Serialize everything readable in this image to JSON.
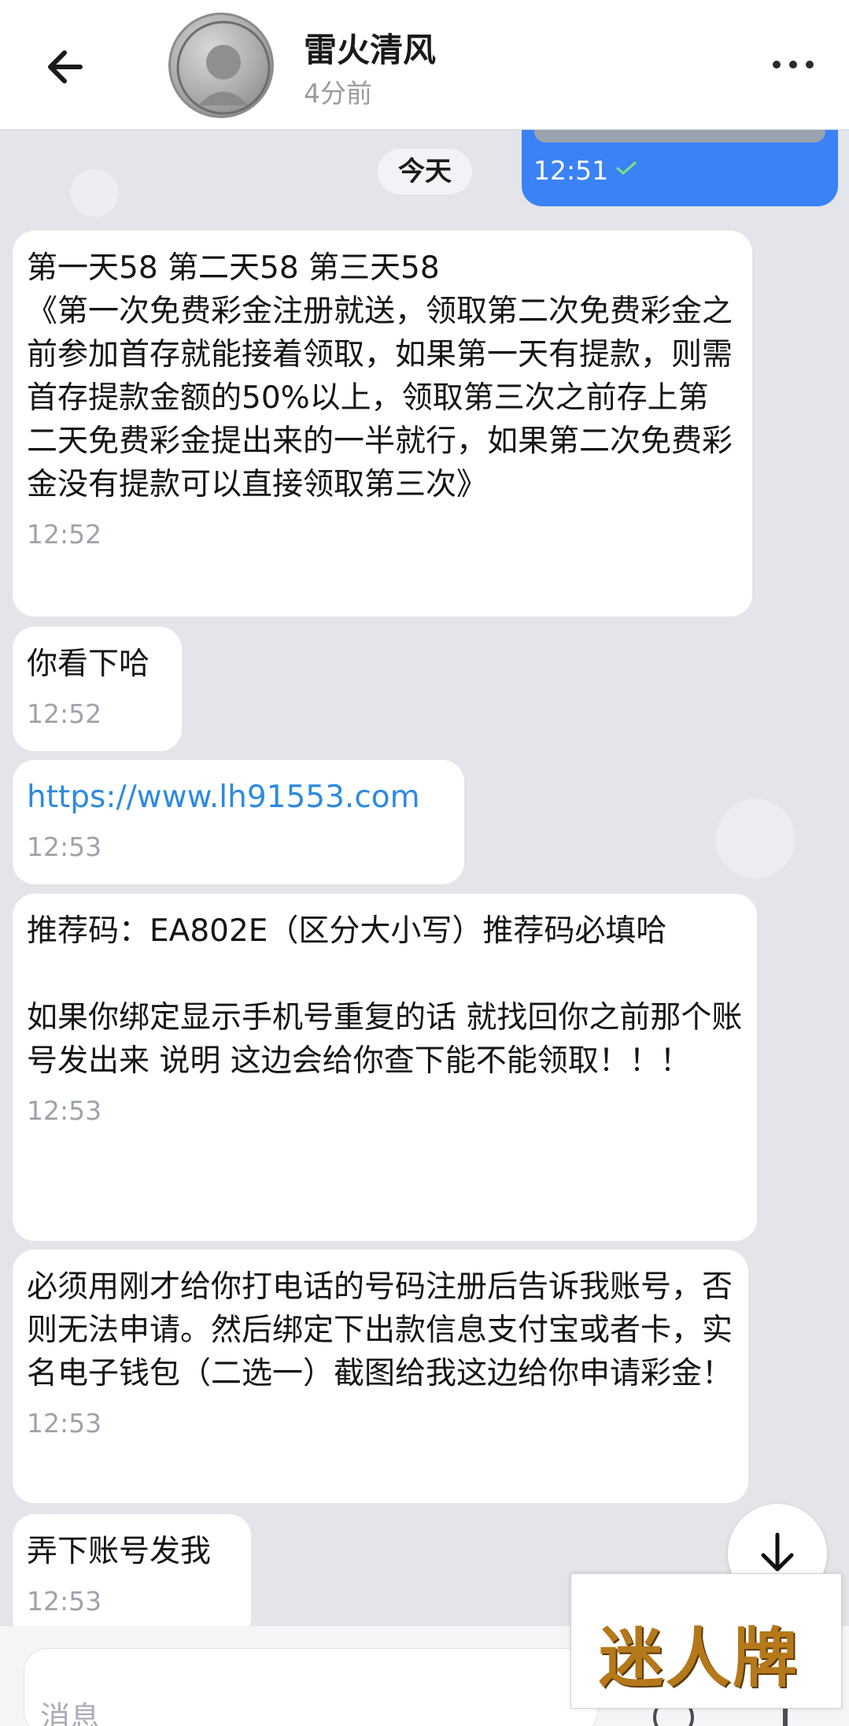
{
  "header": {
    "title": "雷火清风",
    "subtitle": "4分前"
  },
  "outgoing": {
    "time": "12:51"
  },
  "date_chip": "今天",
  "messages": [
    {
      "text": "第一天58 第二天58   第三天58\n《第一次免费彩金注册就送，领取第二次免费彩金之前参加首存就能接着领取，如果第一天有提款，则需首存提款金额的50%以上，领取第三次之前存上第二天免费彩金提出来的一半就行，如果第二次免费彩金没有提款可以直接领取第三次》",
      "time": "12:52"
    },
    {
      "text": "你看下哈",
      "time": "12:52"
    },
    {
      "text": "https://www.lh91553.com",
      "time": "12:53"
    },
    {
      "text": "推荐码：EA802E（区分大小写）推荐码必填哈\n\n如果你绑定显示手机号重复的话 就找回你之前那个账   号发出来 说明   这边会给你查下能不能领取！！！",
      "time": "12:53"
    },
    {
      "text": "必须用刚才给你打电话的号码注册后告诉我账号，否则无法申请。然后绑定下出款信息支付宝或者卡，实名电子钱包（二选一）截图给我这边给你申请彩金！",
      "time": "12:53"
    },
    {
      "text": "弄下账号发我",
      "time": "12:53"
    }
  ],
  "composer": {
    "placeholder": "消息"
  },
  "watermark": "迷人牌",
  "colors": {
    "outgoing_bubble": "#3b82f6",
    "link": "#2d8ae0",
    "read_check": "#7fe07f"
  }
}
